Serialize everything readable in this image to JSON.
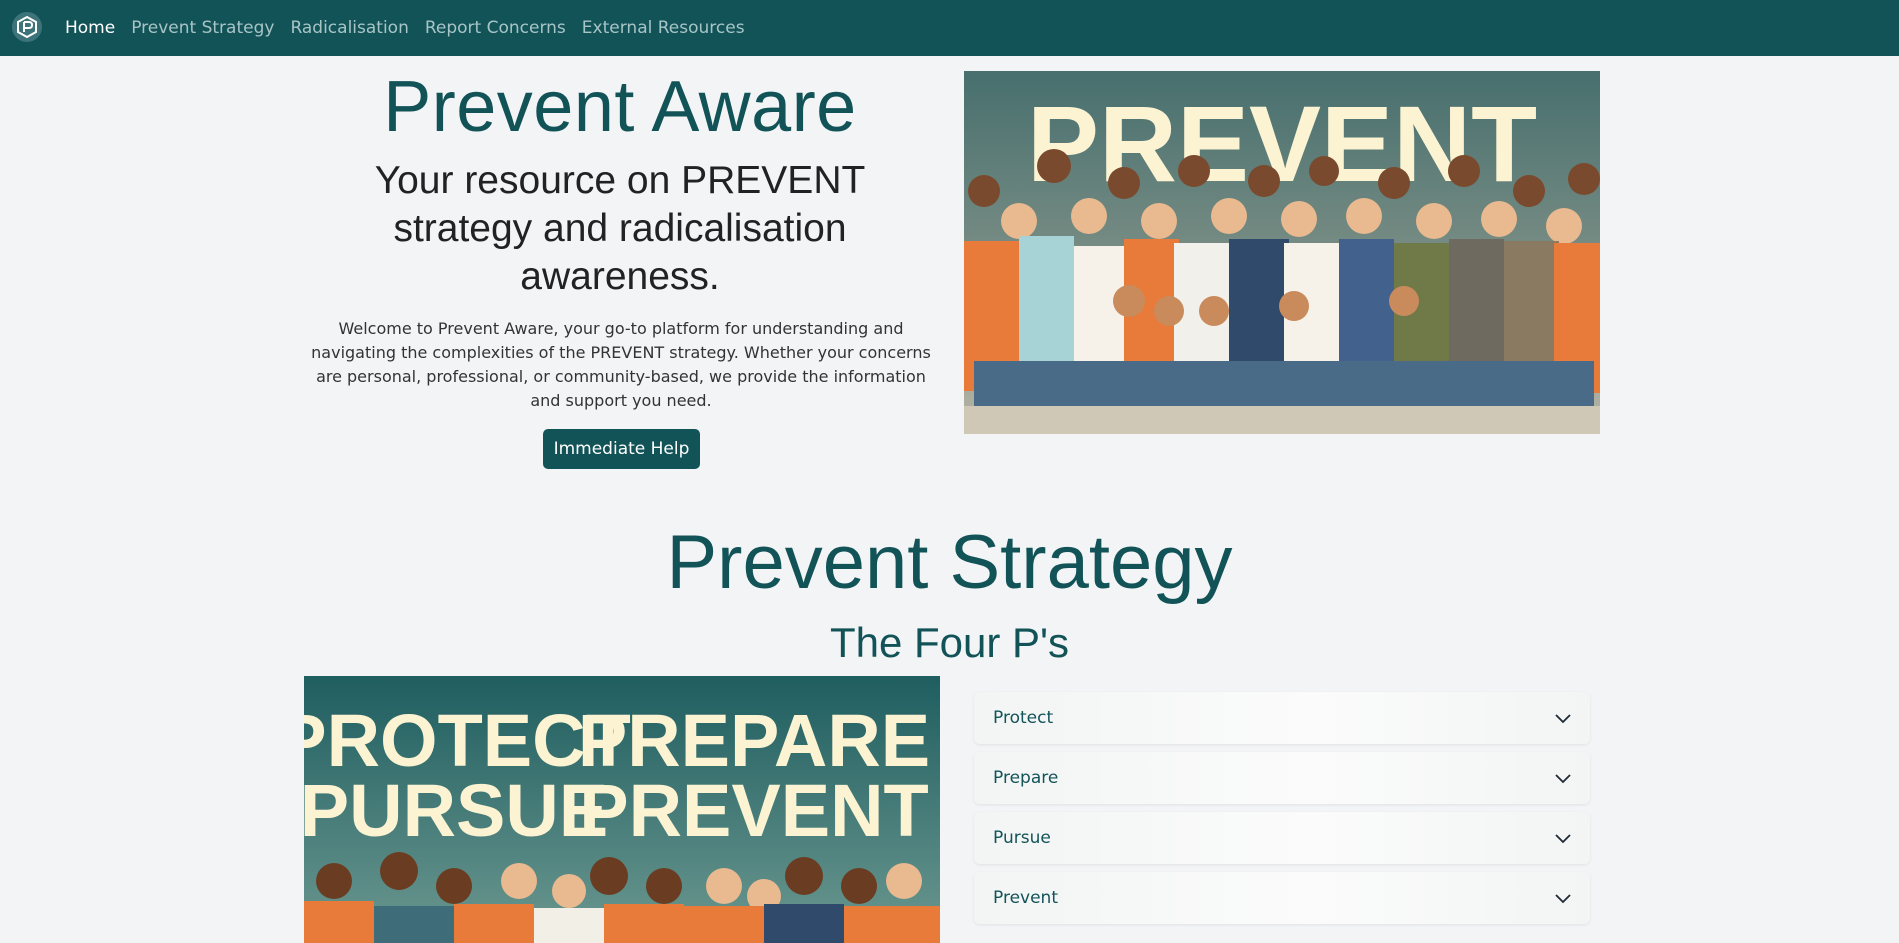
{
  "nav": {
    "brand_icon": "prevent-logo-icon",
    "links": [
      {
        "label": "Home",
        "active": true
      },
      {
        "label": "Prevent Strategy",
        "active": false
      },
      {
        "label": "Radicalisation",
        "active": false
      },
      {
        "label": "Report Concerns",
        "active": false
      },
      {
        "label": "External Resources",
        "active": false
      }
    ]
  },
  "hero": {
    "title": "Prevent Aware",
    "subtitle": "Your resource on PREVENT strategy and radicalisation awareness.",
    "text": "Welcome to Prevent Aware, your go-to platform for understanding and navigating the complexities of the PREVENT strategy. Whether your concerns are personal, professional, or community-based, we provide the information and support you need.",
    "button_label": "Immediate Help",
    "image_text": "PREVENT"
  },
  "strategy": {
    "title": "Prevent Strategy",
    "subtitle": "The Four P's",
    "image_text": {
      "line1_left": "PROTECT",
      "line1_right": "PREPARE",
      "line2_left": "PURSUE",
      "line2_right": "PREVENT"
    },
    "accordion": [
      {
        "label": "Protect",
        "icon": "chevron-down-icon"
      },
      {
        "label": "Prepare",
        "icon": "chevron-down-icon"
      },
      {
        "label": "Pursue",
        "icon": "chevron-down-icon"
      },
      {
        "label": "Prevent",
        "icon": "chevron-down-icon"
      }
    ]
  },
  "colors": {
    "primary": "#125358",
    "background": "#f3f4f6",
    "nav_link": "#a7c4c6",
    "poster_text": "#fbf3d2"
  }
}
